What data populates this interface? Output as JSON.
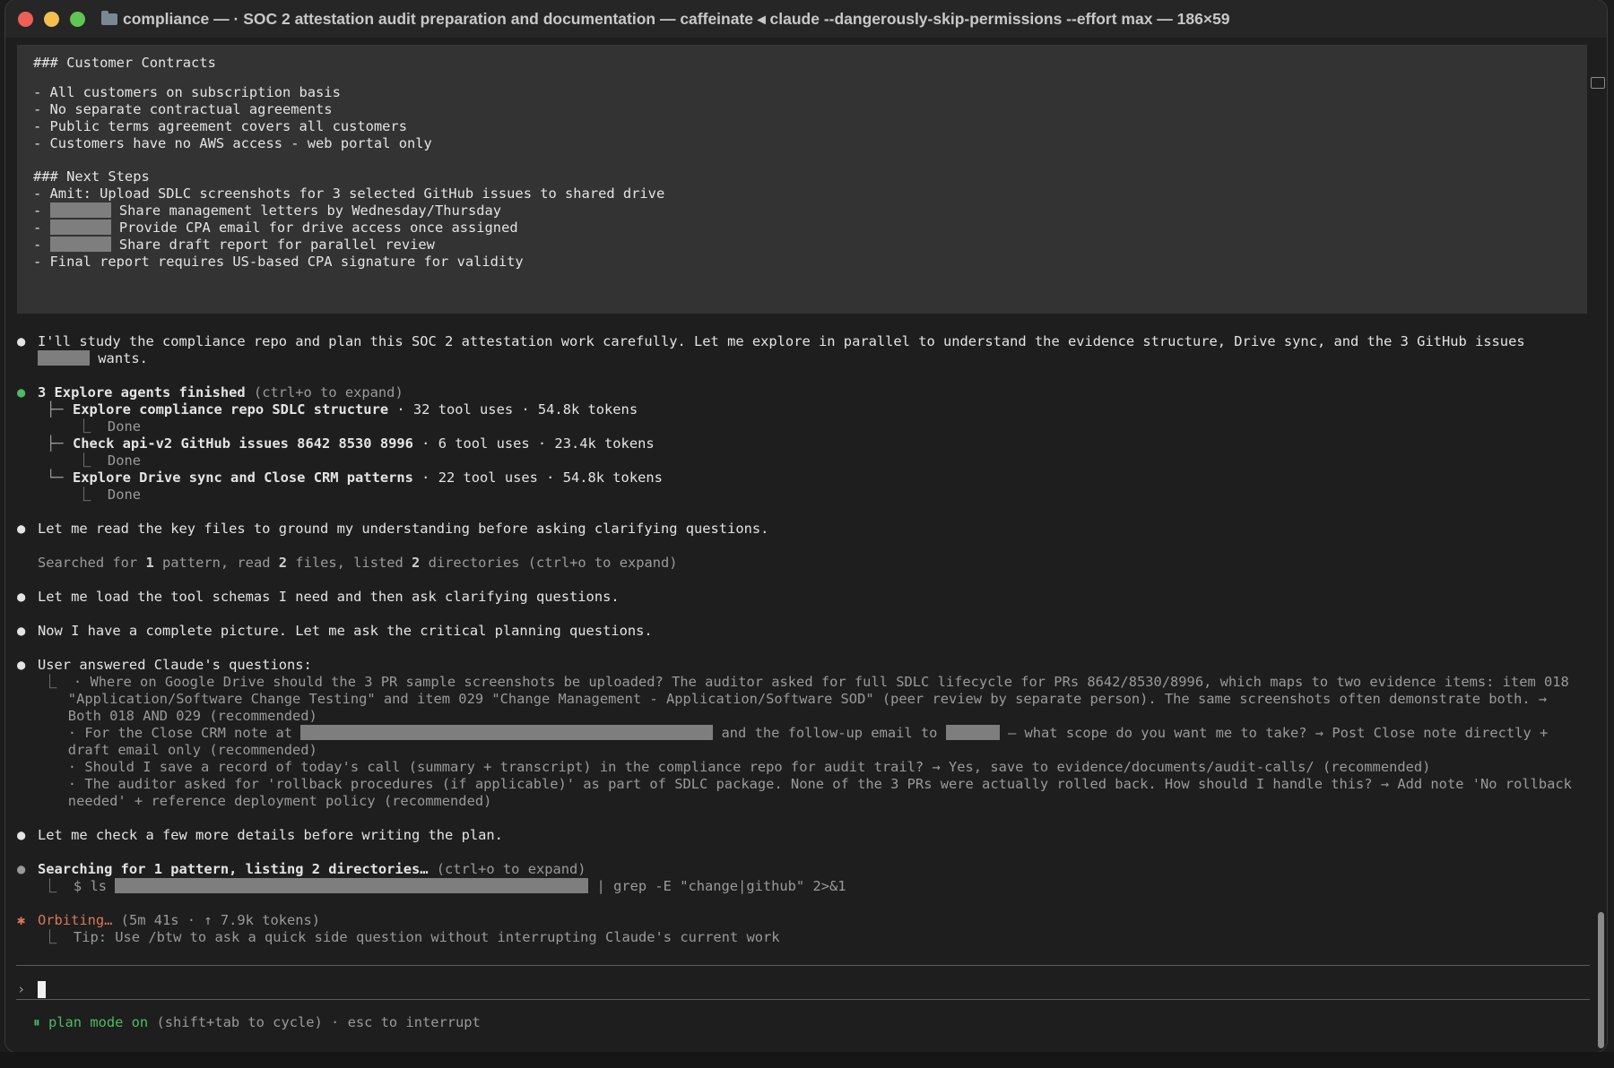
{
  "window": {
    "title": "compliance — · SOC 2 attestation audit preparation and documentation — caffeinate ◂ claude --dangerously-skip-permissions --effort max — 186×59"
  },
  "quote": {
    "h1": "### Customer Contracts",
    "items1": [
      "- All customers on subscription basis",
      "- No separate contractual agreements",
      "- Public terms agreement covers all customers",
      "- Customers have no AWS access - web portal only"
    ],
    "h2": "### Next Steps",
    "step1": "- Amit: Upload SDLC screenshots for 3 selected GitHub issues to shared drive",
    "dash": "-",
    "step2": "Share management letters by Wednesday/Thursday",
    "step3": "Provide CPA email for drive access once assigned",
    "step4": "Share draft report for parallel review",
    "step5": "- Final report requires US-based CPA signature for validity"
  },
  "messages": {
    "bullet": "●",
    "study_1": "I'll study the compliance repo and plan this SOC 2 attestation work carefully. Let me explore in parallel to understand the evidence structure, Drive sync, and the 3 GitHub issues",
    "study_2": "wants.",
    "agents_head": "3 Explore agents finished",
    "agents_hint": " (ctrl+o to expand)",
    "agents": [
      {
        "prefix": "├─ ",
        "name": "Explore compliance repo SDLC structure",
        "stats": " · 32 tool uses · 54.8k tokens",
        "status": "⎿  Done"
      },
      {
        "prefix": "├─ ",
        "name": "Check api-v2 GitHub issues 8642 8530 8996",
        "stats": " · 6 tool uses · 23.4k tokens",
        "status": "⎿  Done"
      },
      {
        "prefix": "└─ ",
        "name": "Explore Drive sync and Close CRM patterns",
        "stats": " · 22 tool uses · 54.8k tokens",
        "status": "⎿  Done"
      }
    ],
    "read_keys": "Let me read the key files to ground my understanding before asking clarifying questions.",
    "searched_pre": "Searched for ",
    "searched_n1": "1",
    "searched_mid": " pattern, read ",
    "searched_n2": "2",
    "searched_mid2": " files, listed ",
    "searched_n3": "2",
    "searched_post": " directories (ctrl+o to expand)",
    "load_schemas": "Let me load the tool schemas I need and then ask clarifying questions.",
    "complete": "Now I have a complete picture. Let me ask the critical planning questions.",
    "user_answered": "User answered Claude's questions:",
    "qa": [
      "⎿  · Where on Google Drive should the 3 PR sample screenshots be uploaded? The auditor asked for full SDLC lifecycle for PRs 8642/8530/8996, which maps to two evidence items: item 018",
      "   \"Application/Software Change Testing\" and item 029 \"Change Management - Application/Software SOD\" (peer review by separate person). The same screenshots often demonstrate both. →",
      "   Both 018 AND 029 (recommended)"
    ],
    "qa_close_pre": "   · For the Close CRM note at ",
    "qa_close_mid": " and the follow-up email to ",
    "qa_close_post": " — what scope do you want me to take? → Post Close note directly +",
    "qa_close_2": "   draft email only (recommended)",
    "qa_save": "   · Should I save a record of today's call (summary + transcript) in the compliance repo for audit trail? → Yes, save to evidence/documents/audit-calls/ (recommended)",
    "qa_rollback_1": "   · The auditor asked for 'rollback procedures (if applicable)' as part of SDLC package. None of the 3 PRs were actually rolled back. How should I handle this? → Add note 'No rollback",
    "qa_rollback_2": "   needed' + reference deployment policy (recommended)",
    "check_more": "Let me check a few more details before writing the plan.",
    "searching_b": "Searching for 1 pattern, listing 2 directories…",
    "searching_hint": " (ctrl+o to expand)",
    "ls_pre": "⎿  $ ls ",
    "ls_post": " | grep -E \"change|github\" 2>&1",
    "orbit_star": "✱",
    "orbiting": "Orbiting…",
    "orbit_stats": " (5m 41s · ↑ 7.9k tokens)",
    "tip": "⎿  Tip: Use /btw to ask a quick side question without interrupting Claude's current work"
  },
  "prompt": {
    "caret": "›"
  },
  "status": {
    "pause_icon": "⏸",
    "plan_mode": "plan mode on",
    "hint": " (shift+tab to cycle) · esc to interrupt"
  }
}
